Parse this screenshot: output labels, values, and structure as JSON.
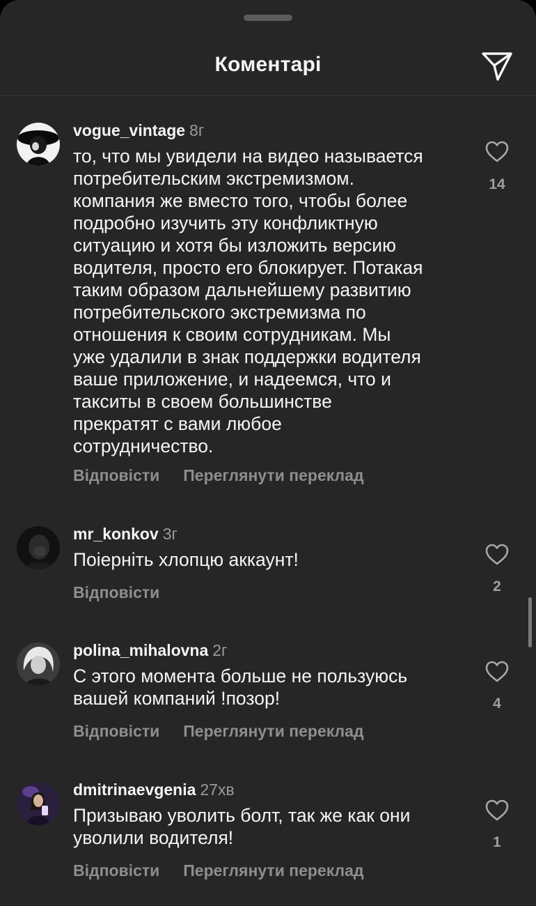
{
  "header": {
    "title": "Коментарі"
  },
  "colors": {
    "background": "#262626",
    "text": "#f5f5f5",
    "muted": "#8e8e8e"
  },
  "comments": [
    {
      "username": "vogue_vintage",
      "time": "8г",
      "text": "то, что мы увидели на видео называется\nпотребительским экстремизмом.\nкомпания же вместо того, чтобы более\nподробно изучить эту конфликтную\nситуацию и хотя бы изложить версию\nводителя, просто его блокирует. Потакая\nтаким образом дальнейшему развитию\nпотребительского экстремизма по\nотношения к своим сотрудникам. Мы\nуже удалили в знак поддержки водителя\nваше приложение, и надеемся, что и\nтакситы в своем большинстве\nпрекратят с вами любое\nсотрудничество.",
      "reply": "Відповісти",
      "translate": "Переглянути переклад",
      "likes": "14"
    },
    {
      "username": "mr_konkov",
      "time": "3г",
      "text": "Поіерніть хлопцю аккаунт!",
      "reply": "Відповісти",
      "likes": "2"
    },
    {
      "username": "polina_mihalovna",
      "time": "2г",
      "text": "С этого момента больше не пользуюсь\nвашей компаний !позор!",
      "reply": "Відповісти",
      "translate": "Переглянути переклад",
      "likes": "4"
    },
    {
      "username": "dmitrinaevgenia",
      "time": "27хв",
      "text": "Призываю уволить болт, так же как они\nуволили водителя!",
      "reply": "Відповісти",
      "translate": "Переглянути переклад",
      "likes": "1"
    }
  ]
}
